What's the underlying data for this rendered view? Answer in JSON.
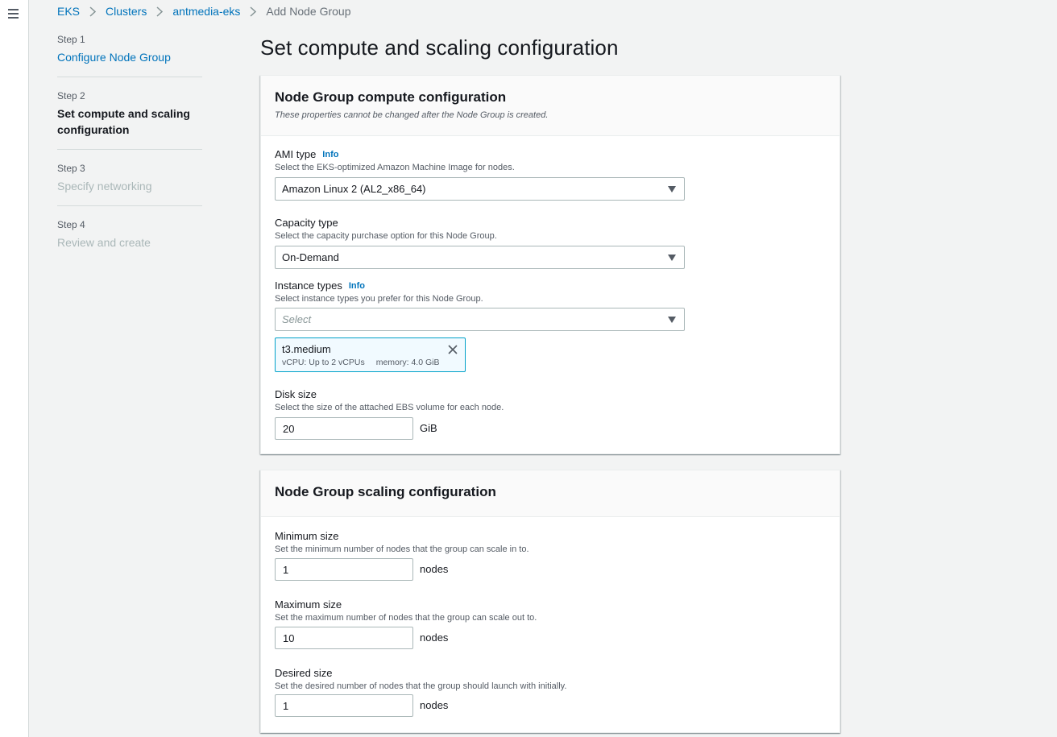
{
  "breadcrumb": {
    "items": [
      "EKS",
      "Clusters",
      "antmedia-eks"
    ],
    "current": "Add Node Group"
  },
  "steps": [
    {
      "num": "Step 1",
      "label": "Configure Node Group"
    },
    {
      "num": "Step 2",
      "label": "Set compute and scaling configuration"
    },
    {
      "num": "Step 3",
      "label": "Specify networking"
    },
    {
      "num": "Step 4",
      "label": "Review and create"
    }
  ],
  "page_title": "Set compute and scaling configuration",
  "compute": {
    "title": "Node Group compute configuration",
    "desc": "These properties cannot be changed after the Node Group is created.",
    "ami": {
      "label": "AMI type",
      "info": "Info",
      "desc": "Select the EKS-optimized Amazon Machine Image for nodes.",
      "value": "Amazon Linux 2 (AL2_x86_64)"
    },
    "capacity": {
      "label": "Capacity type",
      "desc": "Select the capacity purchase option for this Node Group.",
      "value": "On-Demand"
    },
    "instance": {
      "label": "Instance types",
      "info": "Info",
      "desc": "Select instance types you prefer for this Node Group.",
      "placeholder": "Select",
      "token": {
        "name": "t3.medium",
        "vcpu": "vCPU: Up to 2 vCPUs",
        "memory": "memory: 4.0 GiB"
      }
    },
    "disk": {
      "label": "Disk size",
      "desc": "Select the size of the attached EBS volume for each node.",
      "value": "20",
      "unit": "GiB"
    }
  },
  "scaling": {
    "title": "Node Group scaling configuration",
    "min": {
      "label": "Minimum size",
      "desc": "Set the minimum number of nodes that the group can scale in to.",
      "value": "1",
      "unit": "nodes"
    },
    "max": {
      "label": "Maximum size",
      "desc": "Set the maximum number of nodes that the group can scale out to.",
      "value": "10",
      "unit": "nodes"
    },
    "desired": {
      "label": "Desired size",
      "desc": "Set the desired number of nodes that the group should launch with initially.",
      "value": "1",
      "unit": "nodes"
    }
  }
}
